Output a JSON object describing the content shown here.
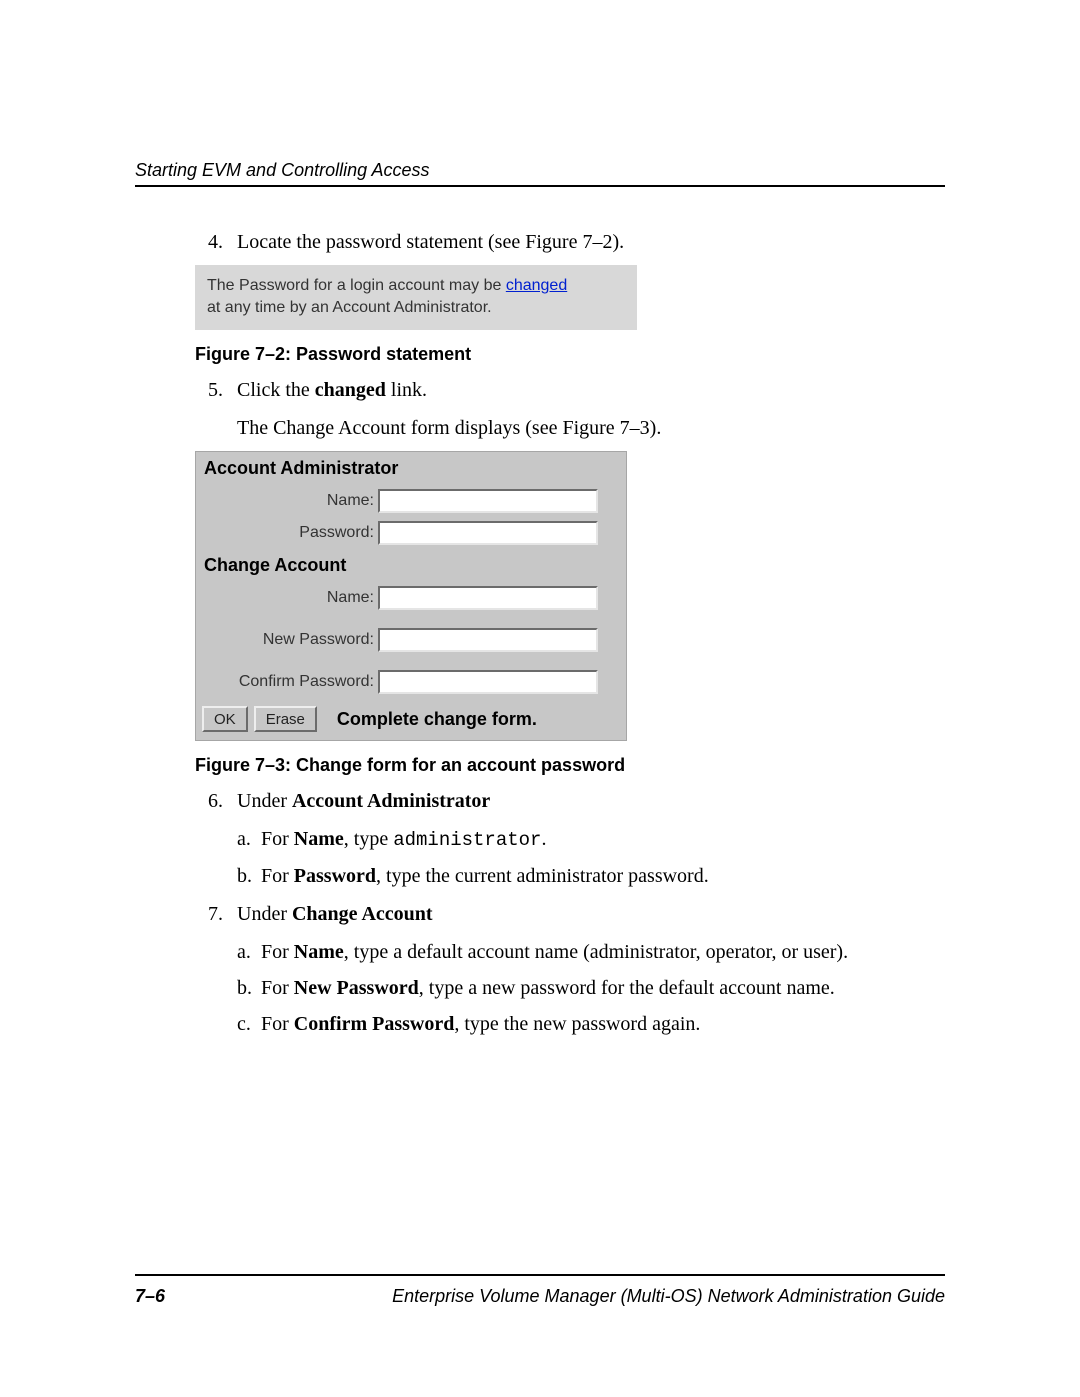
{
  "header": {
    "section_title": "Starting EVM and Controlling Access"
  },
  "steps": {
    "s4_num": "4.",
    "s4_text_a": "Locate the password statement (see Figure 7–2).",
    "s5_num": "5.",
    "s5_text_a": "Click the ",
    "s5_bold": "changed",
    "s5_text_b": " link.",
    "s5_para": "The Change Account form displays (see Figure 7–3).",
    "s6_num": "6.",
    "s6_text_a": "Under ",
    "s6_bold": "Account Administrator",
    "s6a_mark": "a.",
    "s6a_a": "For ",
    "s6a_b": "Name",
    "s6a_c": ", type ",
    "s6a_code": "administrator",
    "s6a_d": ".",
    "s6b_mark": "b.",
    "s6b_a": "For ",
    "s6b_b": "Password",
    "s6b_c": ", type the current administrator password.",
    "s7_num": "7.",
    "s7_text_a": "Under ",
    "s7_bold": "Change Account",
    "s7a_mark": "a.",
    "s7a_a": "For ",
    "s7a_b": "Name",
    "s7a_c": ", type a default account name (administrator, operator, or user).",
    "s7b_mark": "b.",
    "s7b_a": "For ",
    "s7b_b": "New Password",
    "s7b_c": ", type a new password for the default account name.",
    "s7c_mark": "c.",
    "s7c_a": "For ",
    "s7c_b": "Confirm Password",
    "s7c_c": ", type the new password again."
  },
  "fig72": {
    "line1_a": "The Password for a login account may be ",
    "link": "changed",
    "line2": "at any time by an Account Administrator.",
    "caption": "Figure 7–2:  Password statement"
  },
  "fig73": {
    "title1": "Account Administrator",
    "label_name1": "Name:",
    "label_password": "Password:",
    "title2": "Change Account",
    "label_name2": "Name:",
    "label_newpw": "New Password:",
    "label_confirm": "Confirm Password:",
    "btn_ok": "OK",
    "btn_erase": "Erase",
    "complete": "Complete change form.",
    "caption": "Figure 7–3:  Change form for an account password"
  },
  "footer": {
    "page": "7–6",
    "doc_title": "Enterprise Volume Manager (Multi-OS) Network Administration Guide"
  }
}
